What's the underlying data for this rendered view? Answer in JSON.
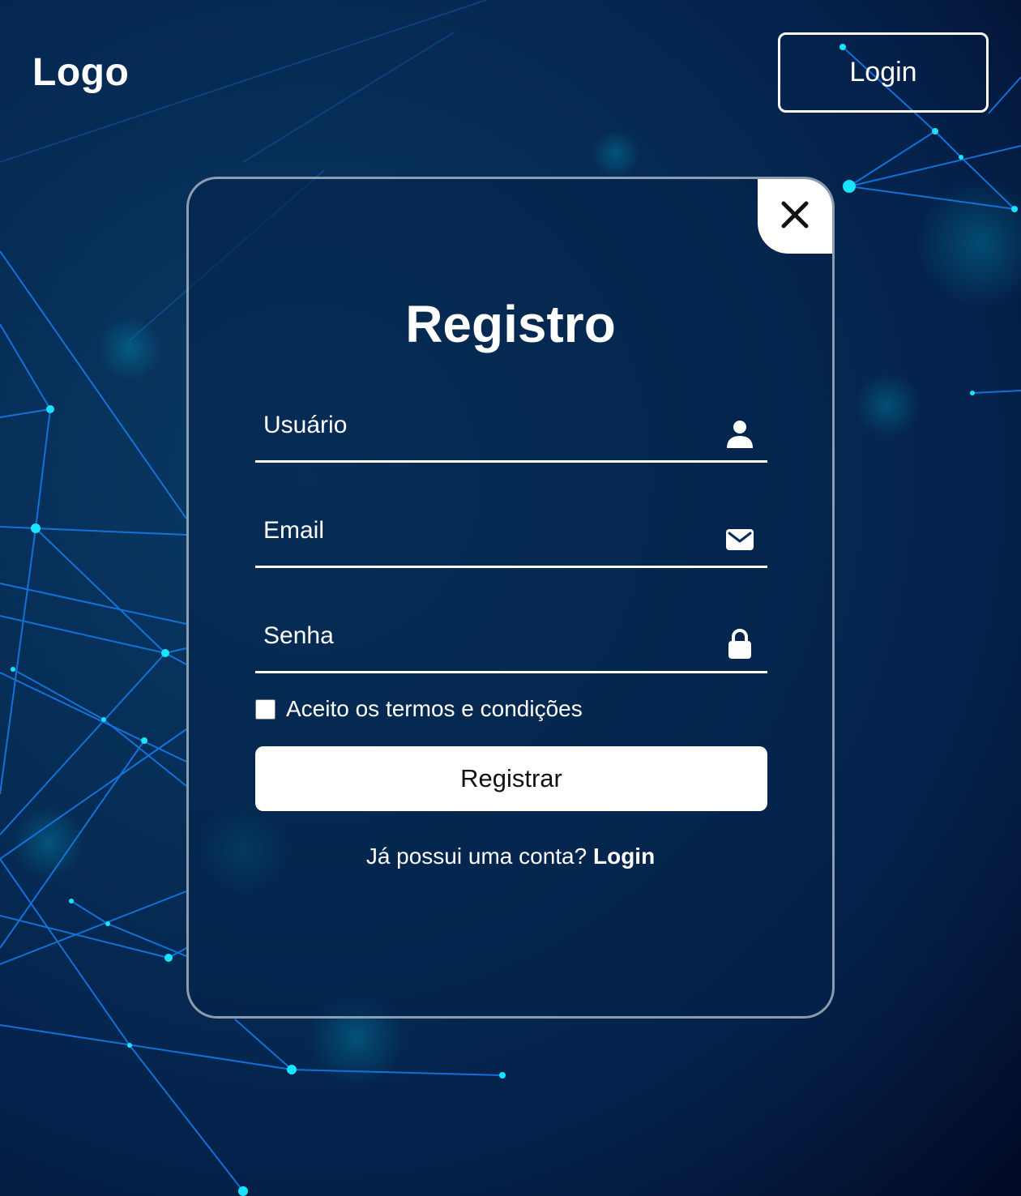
{
  "header": {
    "logo": "Logo",
    "login_button": "Login"
  },
  "modal": {
    "title": "Registro",
    "fields": {
      "username_placeholder": "Usuário",
      "email_placeholder": "Email",
      "password_placeholder": "Senha"
    },
    "terms_label": "Aceito os termos e condições",
    "terms_checked": false,
    "submit_label": "Registrar",
    "switch_prompt": "Já possui uma conta?",
    "switch_link": "Login"
  },
  "icons": {
    "close": "close-icon",
    "username": "user-icon",
    "email": "envelope-icon",
    "password": "lock-icon"
  },
  "colors": {
    "background_dark": "#04214a",
    "accent_line": "#1e88ff",
    "node_glow": "#00e5ff",
    "button_bg": "#ffffff"
  }
}
